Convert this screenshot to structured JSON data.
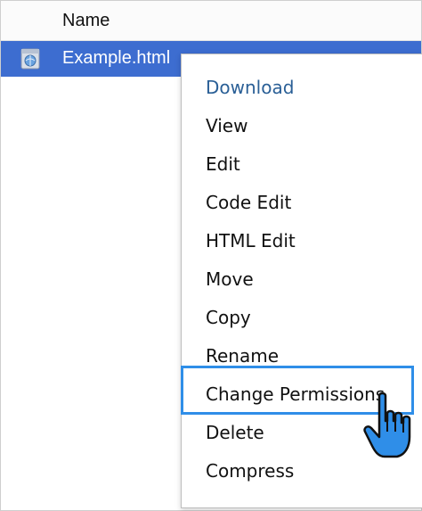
{
  "table": {
    "column_header": "Name",
    "selected_file": {
      "name": "Example.html",
      "icon": "html-file-icon"
    }
  },
  "context_menu": {
    "items": [
      {
        "label": "Download",
        "highlight": true
      },
      {
        "label": "View"
      },
      {
        "label": "Edit"
      },
      {
        "label": "Code Edit"
      },
      {
        "label": "HTML Edit"
      },
      {
        "label": "Move"
      },
      {
        "label": "Copy"
      },
      {
        "label": "Rename"
      },
      {
        "label": "Change Permissions",
        "focused": true
      },
      {
        "label": "Delete"
      },
      {
        "label": "Compress"
      }
    ]
  },
  "colors": {
    "selection": "#3d6dd0",
    "focus_outline": "#2f8ee8",
    "menu_link": "#2a5f96",
    "cursor_fill": "#2f8ee8"
  },
  "cursor": "hand-pointer-icon"
}
